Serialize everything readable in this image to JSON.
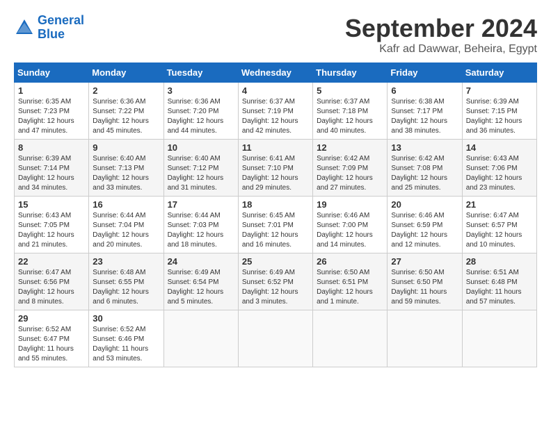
{
  "header": {
    "logo_line1": "General",
    "logo_line2": "Blue",
    "month": "September 2024",
    "location": "Kafr ad Dawwar, Beheira, Egypt"
  },
  "weekdays": [
    "Sunday",
    "Monday",
    "Tuesday",
    "Wednesday",
    "Thursday",
    "Friday",
    "Saturday"
  ],
  "weeks": [
    [
      {
        "day": "1",
        "sunrise": "6:35 AM",
        "sunset": "7:23 PM",
        "daylight": "12 hours and 47 minutes."
      },
      {
        "day": "2",
        "sunrise": "6:36 AM",
        "sunset": "7:22 PM",
        "daylight": "12 hours and 45 minutes."
      },
      {
        "day": "3",
        "sunrise": "6:36 AM",
        "sunset": "7:20 PM",
        "daylight": "12 hours and 44 minutes."
      },
      {
        "day": "4",
        "sunrise": "6:37 AM",
        "sunset": "7:19 PM",
        "daylight": "12 hours and 42 minutes."
      },
      {
        "day": "5",
        "sunrise": "6:37 AM",
        "sunset": "7:18 PM",
        "daylight": "12 hours and 40 minutes."
      },
      {
        "day": "6",
        "sunrise": "6:38 AM",
        "sunset": "7:17 PM",
        "daylight": "12 hours and 38 minutes."
      },
      {
        "day": "7",
        "sunrise": "6:39 AM",
        "sunset": "7:15 PM",
        "daylight": "12 hours and 36 minutes."
      }
    ],
    [
      {
        "day": "8",
        "sunrise": "6:39 AM",
        "sunset": "7:14 PM",
        "daylight": "12 hours and 34 minutes."
      },
      {
        "day": "9",
        "sunrise": "6:40 AM",
        "sunset": "7:13 PM",
        "daylight": "12 hours and 33 minutes."
      },
      {
        "day": "10",
        "sunrise": "6:40 AM",
        "sunset": "7:12 PM",
        "daylight": "12 hours and 31 minutes."
      },
      {
        "day": "11",
        "sunrise": "6:41 AM",
        "sunset": "7:10 PM",
        "daylight": "12 hours and 29 minutes."
      },
      {
        "day": "12",
        "sunrise": "6:42 AM",
        "sunset": "7:09 PM",
        "daylight": "12 hours and 27 minutes."
      },
      {
        "day": "13",
        "sunrise": "6:42 AM",
        "sunset": "7:08 PM",
        "daylight": "12 hours and 25 minutes."
      },
      {
        "day": "14",
        "sunrise": "6:43 AM",
        "sunset": "7:06 PM",
        "daylight": "12 hours and 23 minutes."
      }
    ],
    [
      {
        "day": "15",
        "sunrise": "6:43 AM",
        "sunset": "7:05 PM",
        "daylight": "12 hours and 21 minutes."
      },
      {
        "day": "16",
        "sunrise": "6:44 AM",
        "sunset": "7:04 PM",
        "daylight": "12 hours and 20 minutes."
      },
      {
        "day": "17",
        "sunrise": "6:44 AM",
        "sunset": "7:03 PM",
        "daylight": "12 hours and 18 minutes."
      },
      {
        "day": "18",
        "sunrise": "6:45 AM",
        "sunset": "7:01 PM",
        "daylight": "12 hours and 16 minutes."
      },
      {
        "day": "19",
        "sunrise": "6:46 AM",
        "sunset": "7:00 PM",
        "daylight": "12 hours and 14 minutes."
      },
      {
        "day": "20",
        "sunrise": "6:46 AM",
        "sunset": "6:59 PM",
        "daylight": "12 hours and 12 minutes."
      },
      {
        "day": "21",
        "sunrise": "6:47 AM",
        "sunset": "6:57 PM",
        "daylight": "12 hours and 10 minutes."
      }
    ],
    [
      {
        "day": "22",
        "sunrise": "6:47 AM",
        "sunset": "6:56 PM",
        "daylight": "12 hours and 8 minutes."
      },
      {
        "day": "23",
        "sunrise": "6:48 AM",
        "sunset": "6:55 PM",
        "daylight": "12 hours and 6 minutes."
      },
      {
        "day": "24",
        "sunrise": "6:49 AM",
        "sunset": "6:54 PM",
        "daylight": "12 hours and 5 minutes."
      },
      {
        "day": "25",
        "sunrise": "6:49 AM",
        "sunset": "6:52 PM",
        "daylight": "12 hours and 3 minutes."
      },
      {
        "day": "26",
        "sunrise": "6:50 AM",
        "sunset": "6:51 PM",
        "daylight": "12 hours and 1 minute."
      },
      {
        "day": "27",
        "sunrise": "6:50 AM",
        "sunset": "6:50 PM",
        "daylight": "11 hours and 59 minutes."
      },
      {
        "day": "28",
        "sunrise": "6:51 AM",
        "sunset": "6:48 PM",
        "daylight": "11 hours and 57 minutes."
      }
    ],
    [
      {
        "day": "29",
        "sunrise": "6:52 AM",
        "sunset": "6:47 PM",
        "daylight": "11 hours and 55 minutes."
      },
      {
        "day": "30",
        "sunrise": "6:52 AM",
        "sunset": "6:46 PM",
        "daylight": "11 hours and 53 minutes."
      },
      null,
      null,
      null,
      null,
      null
    ]
  ]
}
